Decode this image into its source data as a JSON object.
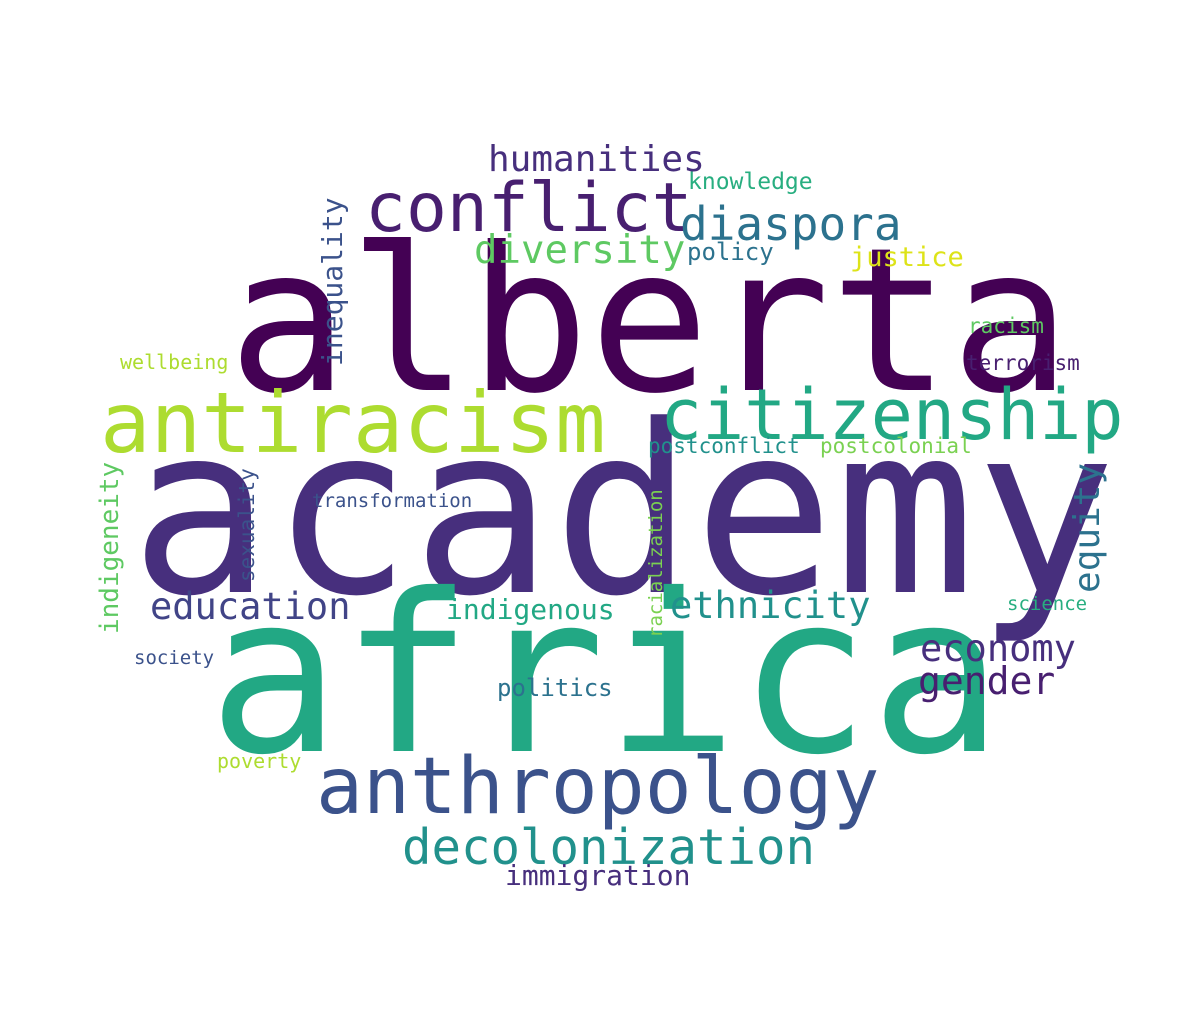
{
  "colors": {
    "background": "#ffffff",
    "dark_purple": "#440154",
    "purple": "#472f7d",
    "indigo": "#3b528b",
    "blue_teal": "#2c728e",
    "teal": "#21918c",
    "green_teal": "#28ae80",
    "green": "#5ec962",
    "lime": "#addc30",
    "yellow": "#fde725"
  },
  "words": {
    "academy": "academy",
    "alberta": "alberta",
    "africa": "africa",
    "anthropology": "anthropology",
    "antiracism": "antiracism",
    "citizenship": "citizenship",
    "conflict": "conflict",
    "decolonization": "decolonization",
    "diaspora": "diaspora",
    "diversity": "diversity",
    "humanities": "humanities",
    "education": "education",
    "ethnicity": "ethnicity",
    "economy": "economy",
    "gender": "gender",
    "equity": "equity",
    "indigenous": "indigenous",
    "inequality": "inequality",
    "indigeneity": "indigeneity",
    "immigration": "immigration",
    "politics": "politics",
    "justice": "justice",
    "knowledge": "knowledge",
    "policy": "policy",
    "racism": "racism",
    "terrorism": "terrorism",
    "wellbeing": "wellbeing",
    "postconflict": "postconflict",
    "postcolonial": "postcolonial",
    "transformation": "transformation",
    "sexuality": "sexuality",
    "racialization": "racialization",
    "science": "science",
    "society": "society",
    "poverty": "poverty"
  }
}
